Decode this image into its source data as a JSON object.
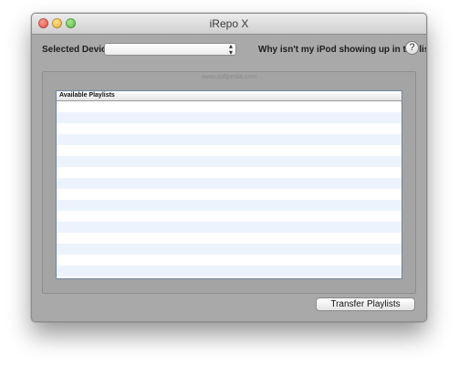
{
  "window": {
    "title": "iRepo X"
  },
  "toolbar": {
    "device_label": "Selected Device:",
    "device_value": "",
    "select_chevron": "⇕",
    "help_text": "Why isn't my iPod showing up in the list?",
    "help_button": "?"
  },
  "playlists": {
    "column_header": "Available Playlists",
    "rows": [],
    "watermark": "www.softpedia.com"
  },
  "actions": {
    "transfer_label": "Transfer Playlists"
  },
  "icons": {
    "close": "traffic-close-icon",
    "minimize": "traffic-minimize-icon",
    "zoom": "traffic-zoom-icon",
    "help": "help-icon",
    "select": "chevron-updown-icon"
  }
}
